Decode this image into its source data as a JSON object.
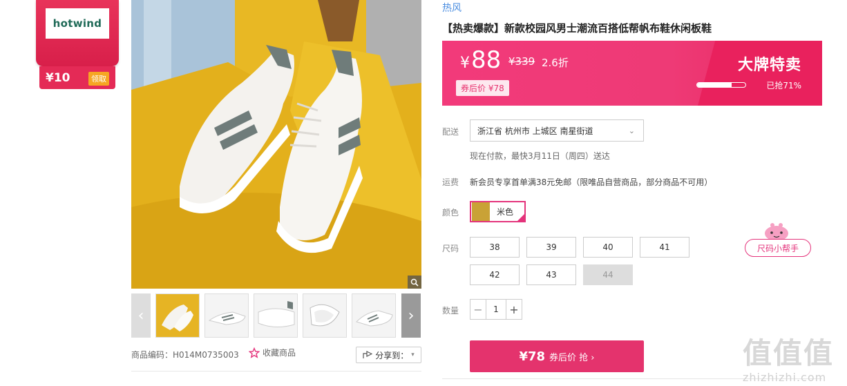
{
  "brand_badge": {
    "logo_text": "hotwind",
    "coupon_value": "¥10",
    "coupon_button": "领取"
  },
  "gallery": {
    "prev_glyph": "‹",
    "next_glyph": "›",
    "thumbnail_count": 5
  },
  "meta": {
    "sku_label": "商品编码：H014M0735003",
    "favorite_label": "收藏商品",
    "share_label": "分享到："
  },
  "product": {
    "brand": "热风",
    "title": "【热卖爆款】新款校园风男士潮流百搭低帮帆布鞋休闲板鞋"
  },
  "price": {
    "currency": "¥",
    "current": "88",
    "original": "¥339",
    "discount": "2.6折",
    "after_coupon": "券后价 ¥78",
    "tag": "大牌特卖",
    "sold_percent_text": "已抢71%",
    "sold_fraction": 0.71
  },
  "delivery": {
    "label": "配送",
    "address": "浙江省 杭州市 上城区 南星街道",
    "note": "现在付款，最快3月11日（周四）送达"
  },
  "shipping": {
    "label": "运费",
    "note": "新会员专享首单满38元免邮（限唯品自营商品，部分商品不可用）"
  },
  "color": {
    "label": "颜色",
    "selected": "米色"
  },
  "size": {
    "label": "尺码",
    "options": [
      "38",
      "39",
      "40",
      "41",
      "42",
      "43",
      "44"
    ]
  },
  "quantity": {
    "label": "数量",
    "value": "1",
    "minus": "−",
    "plus": "+"
  },
  "buy": {
    "price": "¥78",
    "text": "券后价 抢 ›"
  },
  "helper": {
    "label": "尺码小帮手"
  },
  "watermark": {
    "big": "值值值",
    "small": "zhizhizhi.com"
  },
  "colors": {
    "accent": "#e4336d",
    "banner": "#ee3a76",
    "brand_link": "#4a8de0"
  }
}
